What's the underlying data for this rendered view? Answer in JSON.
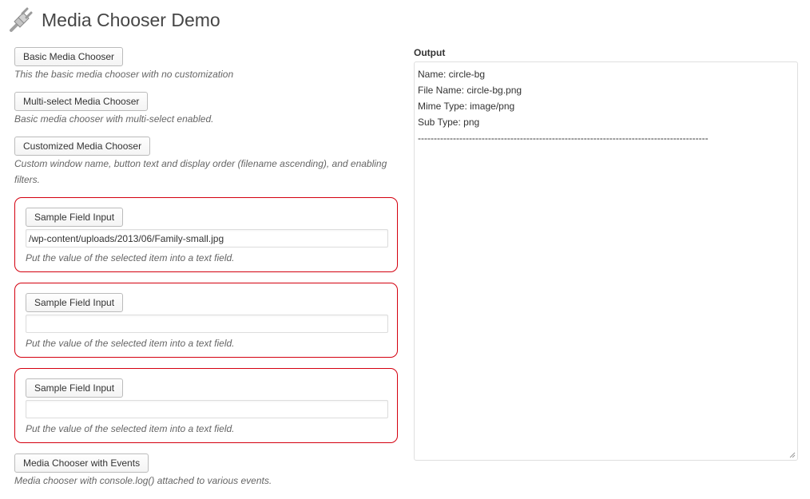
{
  "header": {
    "title": "Media Chooser Demo",
    "icon": "plugin-icon"
  },
  "choosers": [
    {
      "button_label": "Basic Media Chooser",
      "description": "This the basic media chooser with no customization"
    },
    {
      "button_label": "Multi-select Media Chooser",
      "description": "Basic media chooser with multi-select enabled."
    },
    {
      "button_label": "Customized Media Chooser",
      "description": "Custom window name, button text and display order (filename ascending), and enabling filters."
    }
  ],
  "field_inputs": [
    {
      "button_label": "Sample Field Input",
      "value": "/wp-content/uploads/2013/06/Family-small.jpg",
      "description": "Put the value of the selected item into a text field."
    },
    {
      "button_label": "Sample Field Input",
      "value": "",
      "description": "Put the value of the selected item into a text field."
    },
    {
      "button_label": "Sample Field Input",
      "value": "",
      "description": "Put the value of the selected item into a text field."
    }
  ],
  "events_chooser": {
    "button_label": "Media Chooser with Events",
    "description": "Media chooser with console.log() attached to various events."
  },
  "output": {
    "label": "Output",
    "lines": [
      "Name: circle-bg",
      "File Name: circle-bg.png",
      "Mime Type: image/png",
      "Sub Type: png",
      "-------------------------------------------------------------------------------------------"
    ]
  },
  "colors": {
    "field_border": "#d4000f",
    "description_text": "#666666"
  }
}
